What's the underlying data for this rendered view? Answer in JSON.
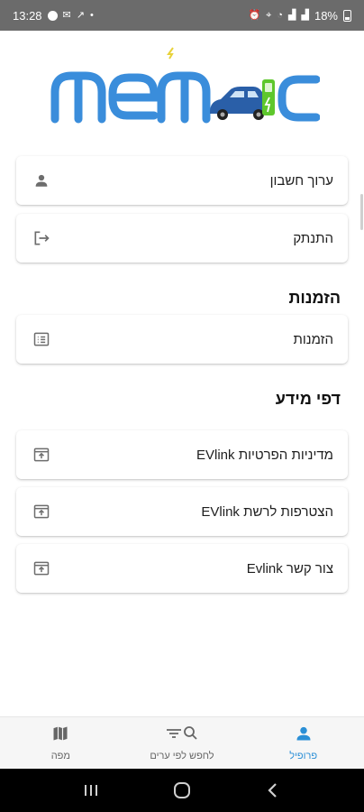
{
  "status_bar": {
    "time": "13:28",
    "battery_percent": "18%"
  },
  "logo": {
    "text": "MEMOC"
  },
  "account_menu": [
    {
      "label": "ערוך חשבון",
      "icon": "person-icon"
    },
    {
      "label": "התנתק",
      "icon": "logout-icon"
    }
  ],
  "orders_section": {
    "title": "הזמנות",
    "items": [
      {
        "label": "הזמנות",
        "icon": "list-icon"
      }
    ]
  },
  "info_section": {
    "title": "דפי מידע",
    "items": [
      {
        "label": "מדיניות הפרטיות EVlink",
        "icon": "open-external-icon"
      },
      {
        "label": "הצטרפות לרשת EVlink",
        "icon": "open-external-icon"
      },
      {
        "label": "צור קשר Evlink",
        "icon": "open-external-icon"
      }
    ]
  },
  "bottom_nav": {
    "items": [
      {
        "label": "מפה",
        "icon": "map-icon",
        "active": false
      },
      {
        "label": "לחפש לפי ערים",
        "icon": "filter-search-icon",
        "active": false
      },
      {
        "label": "פרופיל",
        "icon": "profile-icon",
        "active": true
      }
    ]
  },
  "colors": {
    "accent": "#2b8fd6",
    "logo_blue": "#3a8ddb",
    "logo_green": "#5ec72c"
  }
}
